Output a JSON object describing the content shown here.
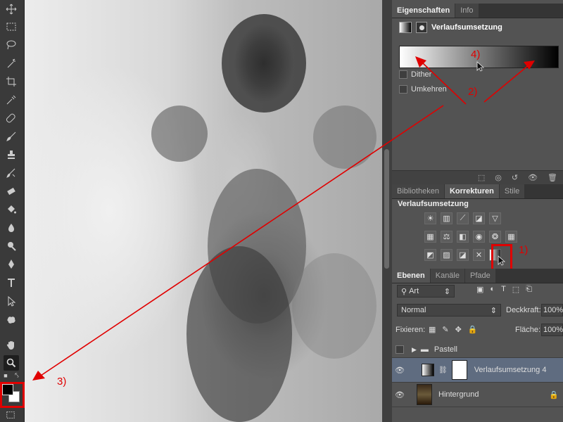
{
  "properties_panel": {
    "tabs": [
      "Eigenschaften",
      "Info"
    ],
    "title": "Verlaufsumsetzung",
    "dither_label": "Dither",
    "reverse_label": "Umkehren"
  },
  "adjustments_panel": {
    "tabs": [
      "Bibliotheken",
      "Korrekturen",
      "Stile"
    ],
    "title": "Verlaufsumsetzung"
  },
  "layers_panel": {
    "tabs": [
      "Ebenen",
      "Kanäle",
      "Pfade"
    ],
    "filter_value": "Art",
    "blend_mode": "Normal",
    "opacity_label": "Deckkraft:",
    "opacity_value": "100%",
    "lock_label": "Fixieren:",
    "fill_label": "Fläche:",
    "fill_value": "100%",
    "layers": [
      {
        "name": "Pastell",
        "type": "group"
      },
      {
        "name": "Verlaufsumsetzung 4",
        "type": "adjustment",
        "selected": true
      },
      {
        "name": "Hintergrund",
        "type": "image"
      }
    ]
  },
  "annotations": {
    "label_1": "1)",
    "label_2": "2)",
    "label_3": "3)",
    "label_4": "4)",
    "color": "#e00000"
  },
  "colors": {
    "foreground": "#000000",
    "background": "#ffffff"
  }
}
